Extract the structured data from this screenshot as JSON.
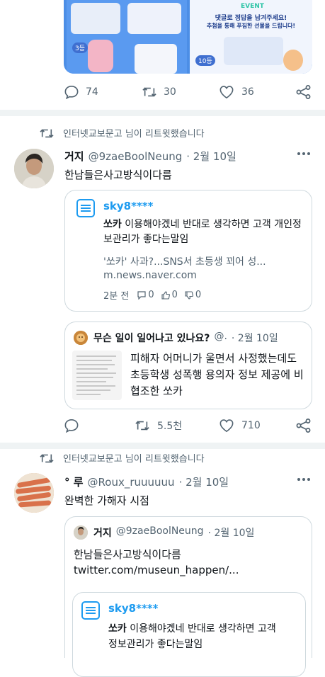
{
  "top_tweet": {
    "banner_event": "EVENT",
    "banner_line1": "댓글로 정답을 남겨주세요!",
    "banner_line2": "추첨을 통해 푸짐한 선물을 드립니다!",
    "banner_badge": "3등",
    "banner_badge2": "10등",
    "actions": {
      "replies": "74",
      "retweets": "30",
      "likes": "36"
    }
  },
  "tweet1": {
    "retweet_note": "인터넷교보문고 님이 리트윗했습니다",
    "name": "거지",
    "handle": "@9zaeBoolNeung",
    "date": "· 2월 10일",
    "text": "한남들은사고방식이다름",
    "naver_card": {
      "user": "sky8****",
      "brand": "쏘카",
      "body_rest": " 이용해야겠네 반대로 생각하면 고객 개인정보관리가 좋다는말임",
      "link_title": "'쏘카' 사과?...SNS서 초등생 꾀어 성...",
      "link_domain": "m.news.naver.com",
      "meta_time": "2분 전",
      "meta_replies": "0",
      "meta_likes": "0",
      "meta_dislikes": "0"
    },
    "quote": {
      "name": "무슨 일이 일어나고 있나요?",
      "handle": "@.",
      "date": "· 2월 10일",
      "text": "피해자 어머니가 울면서 사정했는데도 초등학생 성폭행 용의자 정보 제공에 비협조한 쏘카"
    },
    "actions": {
      "retweets": "5.5천",
      "likes": "710"
    }
  },
  "tweet2": {
    "retweet_note": "인터넷교보문고 님이 리트윗했습니다",
    "name": "° 루",
    "handle": "@Roux_ruuuuuu",
    "date": "· 2월 10일",
    "text": "완벽한 가해자 시점",
    "quote": {
      "name": "거지",
      "handle": "@9zaeBoolNeung",
      "date": "· 2월 10일",
      "text": "한남들은사고방식이다름",
      "link": "twitter.com/museun_happen/...",
      "naver_user": "sky8****",
      "naver_brand": "쏘카",
      "naver_rest": " 이용해야겠네 반대로 생각하면 고객",
      "naver_line2": "정보관리가 좋다는말임"
    }
  },
  "colors": {
    "accent": "#1d9bf0",
    "text": "#0f1419",
    "muted": "#536471",
    "border": "#cfd9de"
  },
  "icons": [
    "reply-icon",
    "retweet-icon",
    "like-icon",
    "share-icon",
    "more-icon",
    "naver-news-icon"
  ]
}
